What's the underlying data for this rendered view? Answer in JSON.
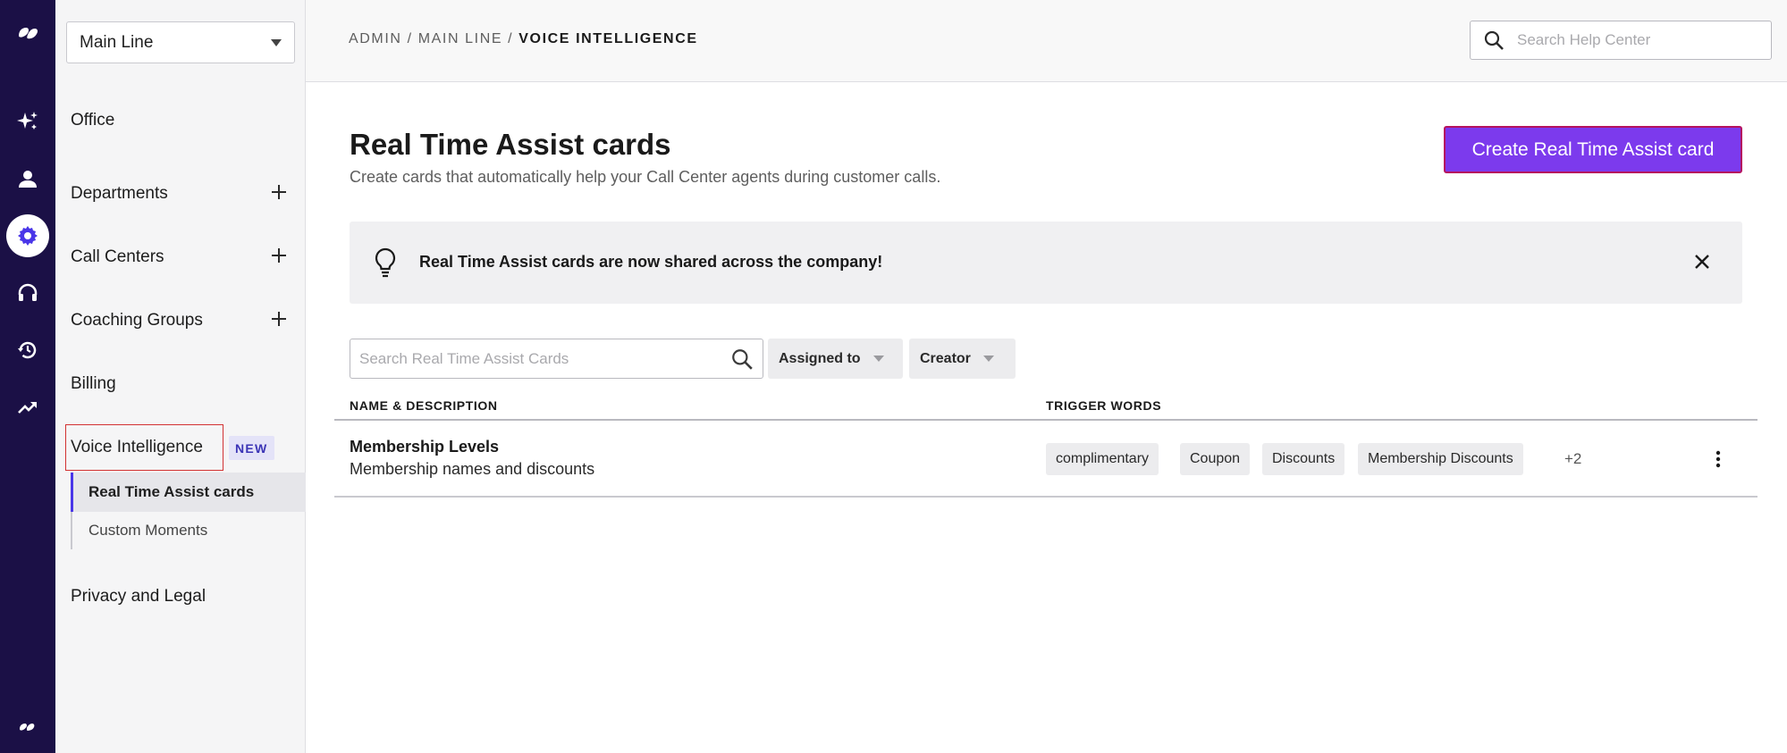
{
  "rail": {
    "icons": [
      "dialpad-logo-icon",
      "sparkle-ai-icon",
      "person-icon",
      "gear-icon",
      "headset-icon",
      "history-icon",
      "trending-icon",
      "dialpad-small-logo-icon"
    ],
    "active": "gear-icon",
    "active_color": "#4a36e8",
    "bg_color": "#1b1046"
  },
  "sidebar": {
    "office_select": "Main Line",
    "items": [
      {
        "label": "Office"
      },
      {
        "label": "Departments"
      },
      {
        "label": "Call Centers"
      },
      {
        "label": "Coaching Groups"
      },
      {
        "label": "Billing"
      },
      {
        "label": "Voice Intelligence",
        "badge": "NEW"
      },
      {
        "label": "Privacy and Legal"
      }
    ],
    "sub_items": [
      {
        "label": "Real Time Assist cards"
      },
      {
        "label": "Custom Moments"
      }
    ]
  },
  "topbar": {
    "breadcrumb": {
      "part1": "ADMIN",
      "sep": "/",
      "part2": "MAIN LINE",
      "current": "VOICE INTELLIGENCE"
    },
    "search_placeholder": "Search Help Center"
  },
  "main": {
    "title": "Real Time Assist cards",
    "subtitle": "Create cards that automatically help your Call Center agents during customer calls.",
    "create_button": "Create Real Time Assist card",
    "create_button_color": "#7c3aed",
    "banner_text": "Real Time Assist cards are now shared across the company!",
    "search_placeholder": "Search Real Time Assist Cards",
    "filters": [
      "Assigned to",
      "Creator"
    ],
    "columns": [
      "NAME & DESCRIPTION",
      "TRIGGER WORDS"
    ],
    "rows": [
      {
        "name": "Membership Levels",
        "description": "Membership names and discounts",
        "tags": [
          "complimentary",
          "Coupon",
          "Discounts",
          "Membership Discounts"
        ],
        "more": "+2"
      }
    ]
  }
}
